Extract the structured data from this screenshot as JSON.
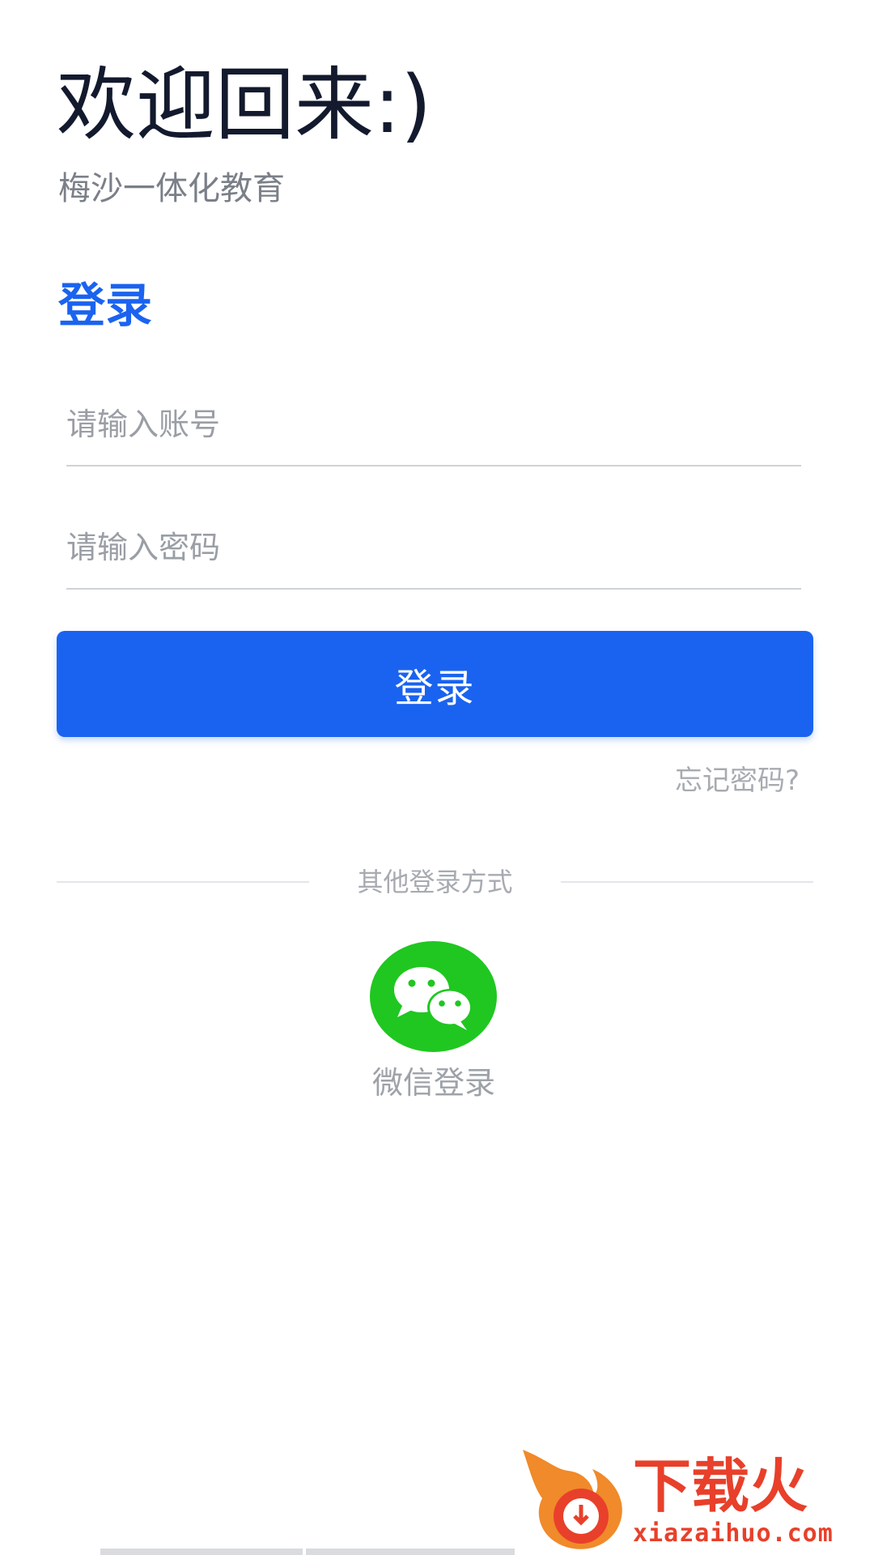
{
  "header": {
    "welcome_title": "欢迎回来:)",
    "subtitle": "梅沙一体化教育"
  },
  "login_form": {
    "heading": "登录",
    "account_placeholder": "请输入账号",
    "password_placeholder": "请输入密码",
    "submit_label": "登录",
    "forgot_password": "忘记密码?"
  },
  "other_login": {
    "divider_text": "其他登录方式",
    "wechat_label": "微信登录",
    "wechat_icon": "wechat-icon"
  },
  "watermark": {
    "logo_text": "下载火",
    "url": "xiazaihuo.com"
  },
  "colors": {
    "primary": "#1a63f0",
    "title": "#131a2e",
    "wechat": "#1fc720",
    "watermark": "#e8402a"
  }
}
